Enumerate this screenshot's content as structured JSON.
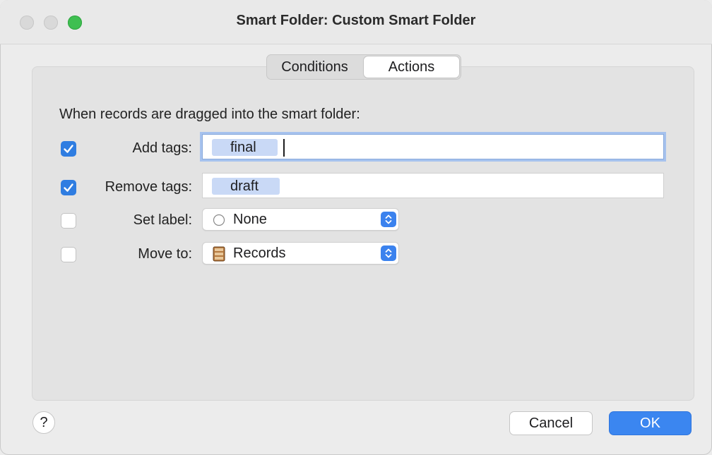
{
  "window": {
    "title": "Smart Folder: Custom Smart Folder"
  },
  "tabs": [
    {
      "label": "Conditions",
      "active": false
    },
    {
      "label": "Actions",
      "active": true
    }
  ],
  "intro": "When records are dragged into the smart folder:",
  "rows": {
    "add_tags": {
      "label": "Add tags:",
      "checked": true,
      "token": "final"
    },
    "remove_tags": {
      "label": "Remove tags:",
      "checked": true,
      "token": "draft"
    },
    "set_label": {
      "label": "Set label:",
      "checked": false,
      "value": "None",
      "icon": "empty-circle-icon"
    },
    "move_to": {
      "label": "Move to:",
      "checked": false,
      "value": "Records",
      "icon": "database-icon"
    }
  },
  "footer": {
    "help": "?",
    "cancel": "Cancel",
    "ok": "OK"
  },
  "colors": {
    "accent": "#3b86f0",
    "checkbox": "#2f7de1",
    "token": "#c9d9f6",
    "zoom": "#3fbf51"
  }
}
